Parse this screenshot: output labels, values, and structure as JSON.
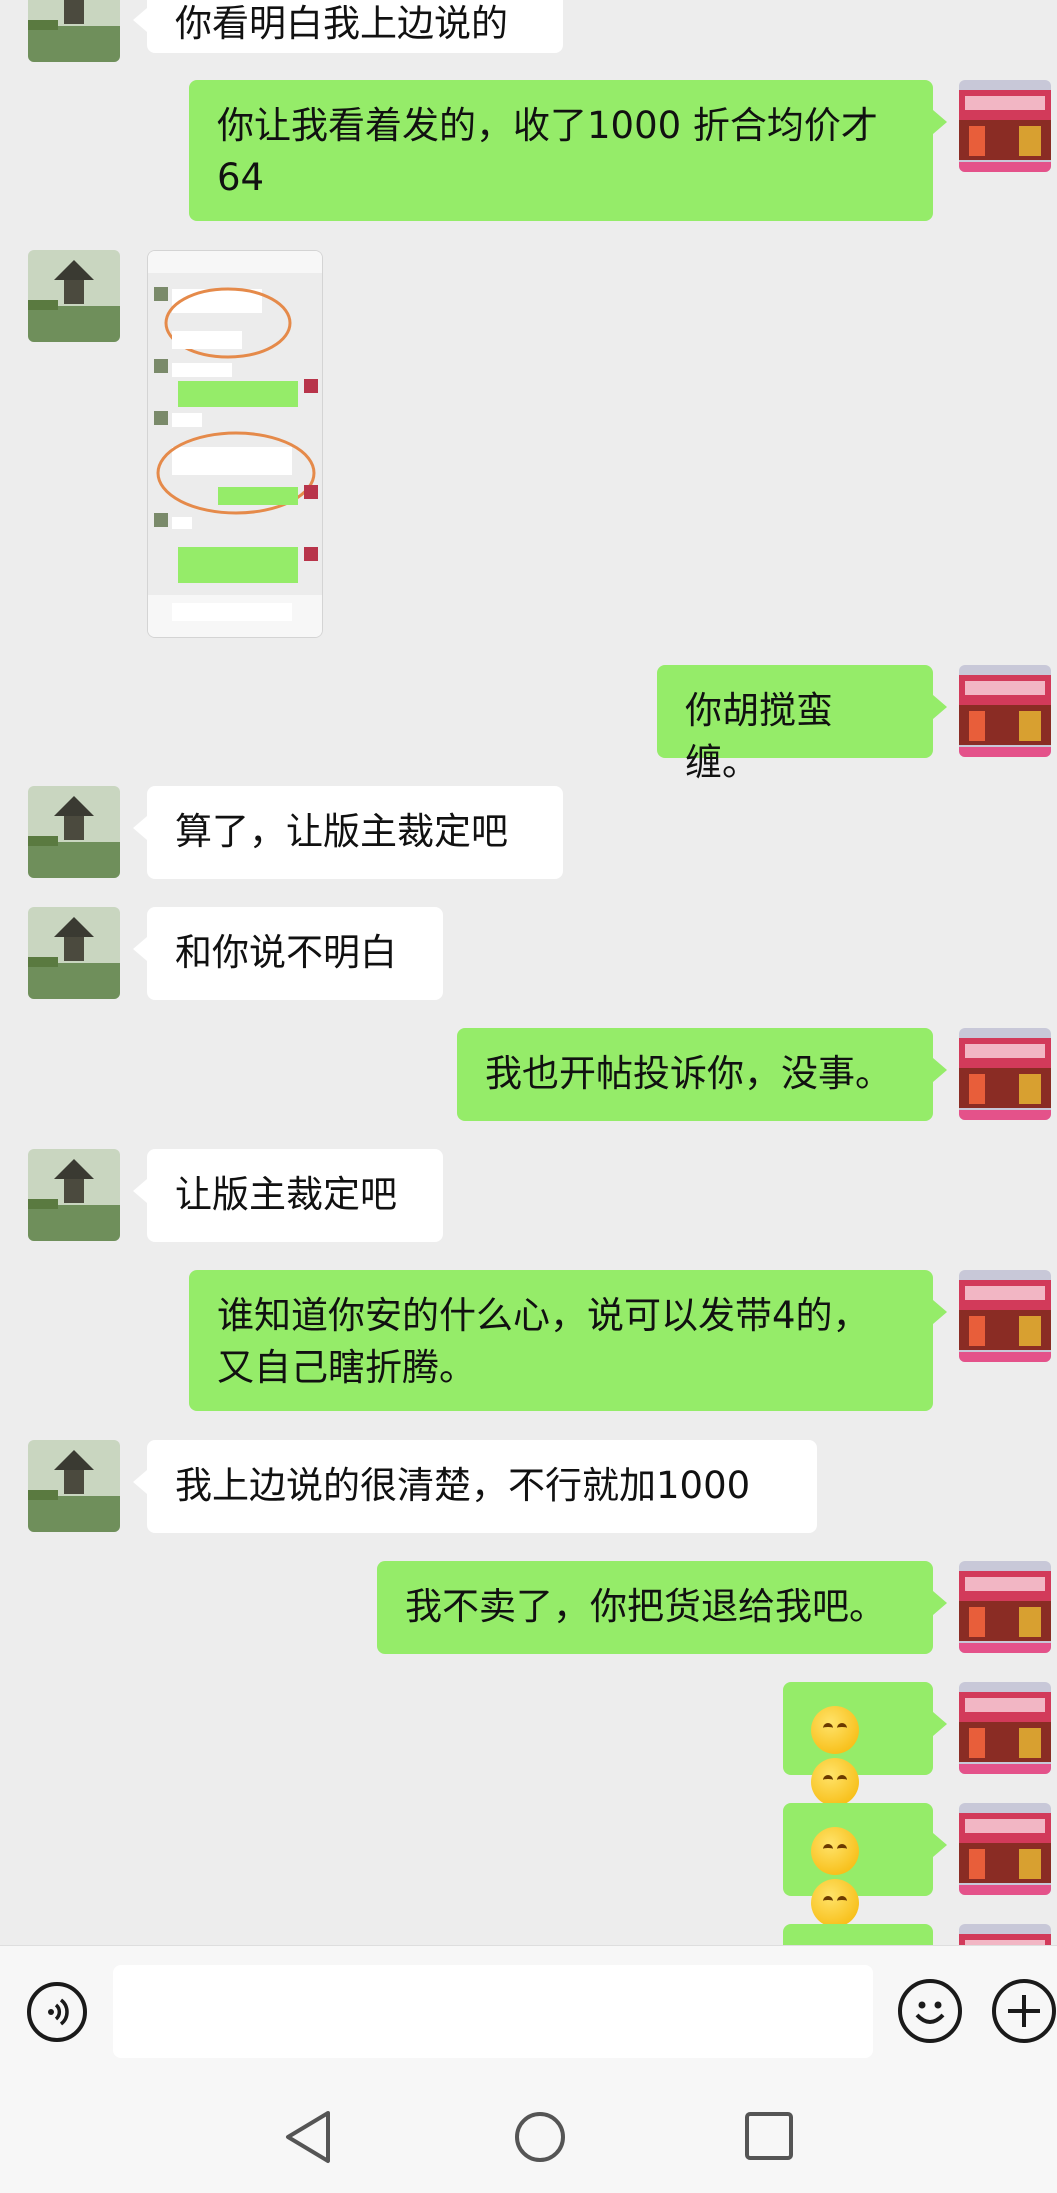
{
  "messages": [
    {
      "side": "in",
      "text": "你看明白我上边说的"
    },
    {
      "side": "out",
      "text": "你让我看着发的，收了1000 折合均价才64"
    },
    {
      "side": "in",
      "type": "image",
      "alt": ""
    },
    {
      "side": "out",
      "text": "你胡搅蛮缠。"
    },
    {
      "side": "in",
      "text": "算了，让版主裁定吧"
    },
    {
      "side": "in",
      "text": "和你说不明白"
    },
    {
      "side": "out",
      "text": "我也开帖投诉你，没事。"
    },
    {
      "side": "in",
      "text": "让版主裁定吧"
    },
    {
      "side": "out",
      "text": "谁知道你安的什么心，说可以发带4的，又自己瞎折腾。"
    },
    {
      "side": "in",
      "text": "我上边说的很清楚，不行就加1000"
    },
    {
      "side": "out",
      "text": "我不卖了，你把货退给我吧。"
    },
    {
      "side": "out",
      "type": "emoji",
      "emoji": "smirk-emoji x2"
    },
    {
      "side": "out",
      "type": "emoji",
      "emoji": "smirk-emoji x2"
    }
  ],
  "input_bar": {
    "voice_icon": "voice-icon",
    "emoji_icon": "emoji-icon",
    "plus_icon": "plus-icon",
    "text_value": ""
  },
  "nav_bar": {
    "back_icon": "triangle-back-icon",
    "home_icon": "circle-home-icon",
    "recents_icon": "square-recents-icon"
  },
  "colors": {
    "background": "#ededed",
    "outgoing_bubble": "#95ec69",
    "incoming_bubble": "#ffffff"
  }
}
